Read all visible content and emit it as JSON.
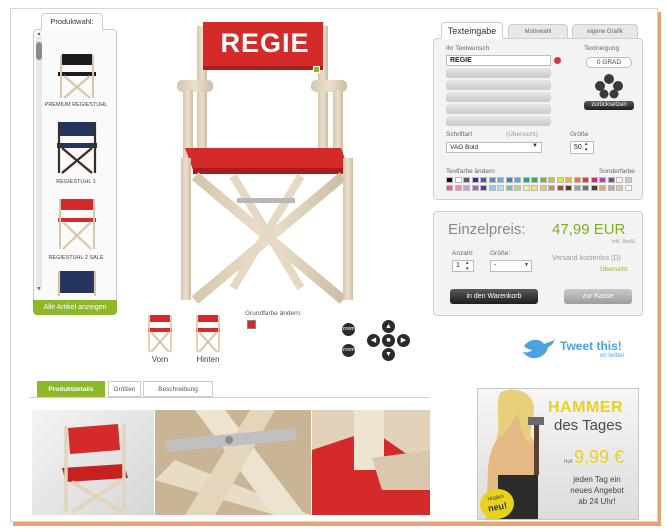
{
  "sidebar": {
    "tab_label": "Produktwahl:",
    "items": [
      {
        "label": "PREMIUM REGIESTUHL"
      },
      {
        "label": "REGIESTUHL 1"
      },
      {
        "label": "REGIESTUHL 2 SALE"
      }
    ],
    "show_all_label": "Alle Artikel anzeigen"
  },
  "chair": {
    "back_text": "REGIE"
  },
  "views": {
    "front_label": "Vorn",
    "back_label": "Hinten",
    "base_color_label": "Grundfarbe ändern:"
  },
  "text_panel": {
    "tabs": [
      "Texteingabe",
      "Motivwahl",
      "eigene Grafik"
    ],
    "wish_label": "Ihr Textwunsch",
    "line1_value": "REGIE",
    "tilt_label": "Textneigung",
    "tilt_value": "0 GRAD",
    "reset_label": "zurücksetzen",
    "font_label": "Schriftart",
    "overview_label": "(Übersicht)",
    "font_value": "VAG Bold",
    "size_label": "Größe",
    "size_value": "50",
    "color_label": "Textfarbe ändern",
    "special_color_label": "Sonderfarbe"
  },
  "price_panel": {
    "label": "Einzelpreis:",
    "price": "47,99 EUR",
    "vat_note": "inkl. MwSt.",
    "qty_label": "Anzahl:",
    "qty_value": "1",
    "size_label": "Größe:",
    "size_value": "-",
    "shipping": "Versand kostenlos (D)",
    "overview": "Übersicht",
    "cart_button": "in den Warenkorb",
    "checkout_button": "zur Kasse"
  },
  "tweet": {
    "main": "Tweet this!",
    "sub": "on twitter"
  },
  "details": {
    "tabs": [
      "Produktdetails",
      "Größen",
      "Beschreibung"
    ]
  },
  "promo": {
    "title1": "HAMMER",
    "title2": "des Tages",
    "price_prefix": "nur",
    "price": "9,99 €",
    "text1": "jeden Tag ein",
    "text2": "neues Angebot",
    "text3": "ab 24 Uhr!",
    "badge1": "Nüglich",
    "badge2": "neu!"
  },
  "colors": {
    "accent_green": "#8cb82a",
    "chair_red": "#d42a2a",
    "wood": "#e2d3bd",
    "price_green": "#7fae1b",
    "promo_yellow": "#e8d21c"
  },
  "swatches_row1": [
    "#111111",
    "#ffffff",
    "#5a5a5a",
    "#2b3a8c",
    "#4a5aa8",
    "#6f7fc0",
    "#8a9fd8",
    "#3c7fc4",
    "#55a8d8",
    "#2e9e9e",
    "#3aa86a",
    "#78b83a",
    "#b8c83a",
    "#e8e03a",
    "#f0b43a",
    "#e87a2a",
    "#d83a3a",
    "#c82a6a",
    "#a84a9a",
    "#7a4a9a",
    "#f0f0f0",
    "#c8c8c8"
  ],
  "swatches_row2": [
    "#e85a9a",
    "#f08ac0",
    "#c8a0d8",
    "#9a6ac8",
    "#5a3a8a",
    "#8ac8e8",
    "#b0e0f0",
    "#6ac8b0",
    "#a8d878",
    "#e8f0a0",
    "#f8e080",
    "#f0c080",
    "#c89060",
    "#8a5a3a",
    "#5a3a2a",
    "#a0a0a0",
    "#707070",
    "#404040",
    "#d8b070",
    "#b0b0b0",
    "#e0c8a0",
    "#ffffff"
  ]
}
